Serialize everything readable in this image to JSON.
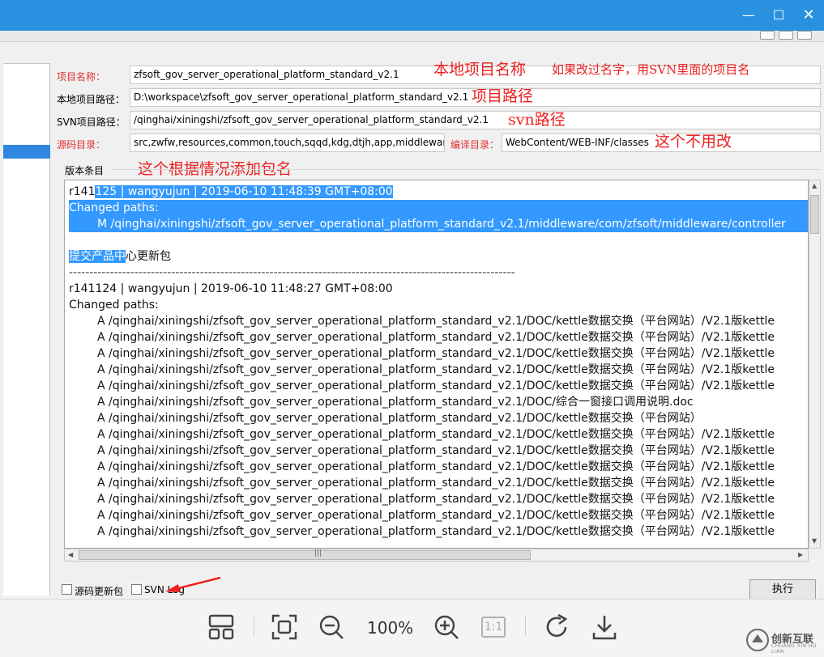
{
  "window": {
    "minimize_glyph": "—",
    "maximize_glyph": "☐",
    "close_glyph": "✕"
  },
  "form": {
    "project_name_label": "项目名称：",
    "project_name_value": "zfsoft_gov_server_operational_platform_standard_v2.1",
    "local_path_label": "本地项目路径：",
    "local_path_value": "D:\\workspace\\zfsoft_gov_server_operational_platform_standard_v2.1",
    "svn_path_label": "SVN项目路径：",
    "svn_path_value": "/qinghai/xiningshi/zfsoft_gov_server_operational_platform_standard_v2.1",
    "source_dir_label": "源码目录：",
    "source_dir_value": "src,zwfw,resources,common,touch,sqqd,kdg,dtjh,app,middleware",
    "compile_dir_label": "编译目录：",
    "compile_dir_value": "WebContent/WEB-INF/classes",
    "version_group_label": "版本条目"
  },
  "annotations": {
    "project_name_note": "本地项目名称",
    "project_name_note_small": "如果改过名字，用SVN里面的项目名",
    "project_path_note": "项目路径",
    "svn_path_note": "svn路径",
    "no_change_note": "这个不用改",
    "add_package_note": "这个根据情况添加包名"
  },
  "log": {
    "entry1_head_a": "r141",
    "entry1_head_b": "125 | wangyujun | 2019-06-10 11:48:39 GMT+08:00",
    "entry1_changed": "Changed paths:",
    "entry1_path": "M /qinghai/xiningshi/zfsoft_gov_server_operational_platform_standard_v2.1/middleware/com/zfsoft/middleware/controller",
    "entry1_msg_a": "提交产品中",
    "entry1_msg_b": "心更新包",
    "separator": "-------------------------------------------------------------------------------------------------------------",
    "entry2_head": "r141124 | wangyujun | 2019-06-10 11:48:27 GMT+08:00",
    "entry2_changed": "Changed paths:",
    "paths": [
      "A /qinghai/xiningshi/zfsoft_gov_server_operational_platform_standard_v2.1/DOC/kettle数据交换（平台网站）/V2.1版kettle",
      "A /qinghai/xiningshi/zfsoft_gov_server_operational_platform_standard_v2.1/DOC/kettle数据交换（平台网站）/V2.1版kettle",
      "A /qinghai/xiningshi/zfsoft_gov_server_operational_platform_standard_v2.1/DOC/kettle数据交换（平台网站）/V2.1版kettle",
      "A /qinghai/xiningshi/zfsoft_gov_server_operational_platform_standard_v2.1/DOC/kettle数据交换（平台网站）/V2.1版kettle",
      "A /qinghai/xiningshi/zfsoft_gov_server_operational_platform_standard_v2.1/DOC/kettle数据交换（平台网站）/V2.1版kettle",
      "A /qinghai/xiningshi/zfsoft_gov_server_operational_platform_standard_v2.1/DOC/综合一窗接口调用说明.doc",
      "A /qinghai/xiningshi/zfsoft_gov_server_operational_platform_standard_v2.1/DOC/kettle数据交换（平台网站）",
      "A /qinghai/xiningshi/zfsoft_gov_server_operational_platform_standard_v2.1/DOC/kettle数据交换（平台网站）/V2.1版kettle",
      "A /qinghai/xiningshi/zfsoft_gov_server_operational_platform_standard_v2.1/DOC/kettle数据交换（平台网站）/V2.1版kettle",
      "A /qinghai/xiningshi/zfsoft_gov_server_operational_platform_standard_v2.1/DOC/kettle数据交换（平台网站）/V2.1版kettle",
      "A /qinghai/xiningshi/zfsoft_gov_server_operational_platform_standard_v2.1/DOC/kettle数据交换（平台网站）/V2.1版kettle",
      "A /qinghai/xiningshi/zfsoft_gov_server_operational_platform_standard_v2.1/DOC/kettle数据交换（平台网站）/V2.1版kettle",
      "A /qinghai/xiningshi/zfsoft_gov_server_operational_platform_standard_v2.1/DOC/kettle数据交换（平台网站）/V2.1版kettle",
      "A /qinghai/xiningshi/zfsoft_gov_server_operational_platform_standard_v2.1/DOC/kettle数据交换（平台网站）/V2.1版kettle"
    ]
  },
  "options": {
    "source_update_label": "源码更新包",
    "svn_log_label": "SVN Log",
    "execute_label": "执行"
  },
  "viewer": {
    "zoom": "100%",
    "actual_size_label": "1:1",
    "icons": [
      "thumbnails-icon",
      "fit-screen-icon",
      "zoom-out-icon",
      "zoom-in-icon",
      "actual-size-icon",
      "rotate-icon",
      "download-icon"
    ]
  },
  "watermark": {
    "brand": "创新互联",
    "sub": "CHUANG XIN HU LIAN"
  },
  "colors": {
    "titlebar": "#2a91e0",
    "selection": "#3399ff",
    "annotation": "#ee2020",
    "required_label": "#e03030"
  }
}
